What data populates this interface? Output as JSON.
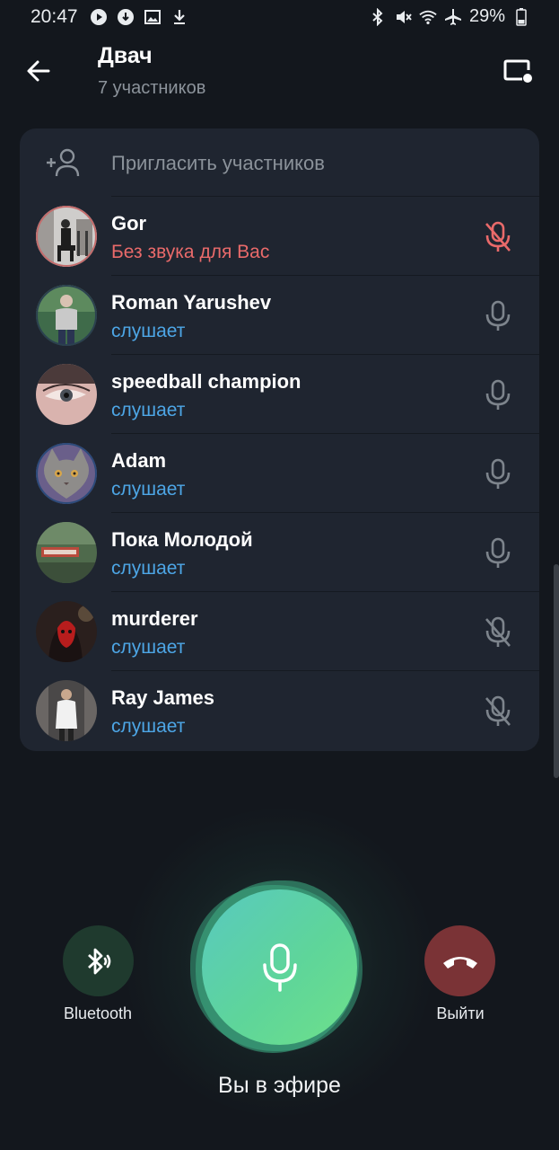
{
  "status_bar": {
    "time": "20:47",
    "battery": "29%",
    "left_icons": [
      "play-circle-icon",
      "download-circle-icon",
      "image-icon",
      "download-icon"
    ],
    "right_icons": [
      "bluetooth-icon",
      "vibrate-mute-icon",
      "wifi-icon",
      "airplane-icon",
      "battery-icon"
    ]
  },
  "header": {
    "title": "Двач",
    "subtitle": "7 участников"
  },
  "invite": {
    "label": "Пригласить участников"
  },
  "participants": [
    {
      "name": "Gor",
      "status": "Без звука для Вас",
      "mic": "muted-red"
    },
    {
      "name": "Roman Yarushev",
      "status": "слушает",
      "mic": "on"
    },
    {
      "name": "speedball champion",
      "status": "слушает",
      "mic": "on"
    },
    {
      "name": "Adam",
      "status": "слушает",
      "mic": "on"
    },
    {
      "name": "Пока Молодой",
      "status": "слушает",
      "mic": "on"
    },
    {
      "name": "murderer",
      "status": "слушает",
      "mic": "off"
    },
    {
      "name": "Ray James",
      "status": "слушает",
      "mic": "off"
    }
  ],
  "controls": {
    "bluetooth_label": "Bluetooth",
    "leave_label": "Выйти",
    "on_air_label": "Вы в эфире"
  },
  "colors": {
    "background": "#13171d",
    "card": "#1f2530",
    "accent_blue": "#4da6e6",
    "muted_red": "#e96a6a",
    "mic_green": "#5ed59a",
    "leave_red": "#7a3336"
  }
}
